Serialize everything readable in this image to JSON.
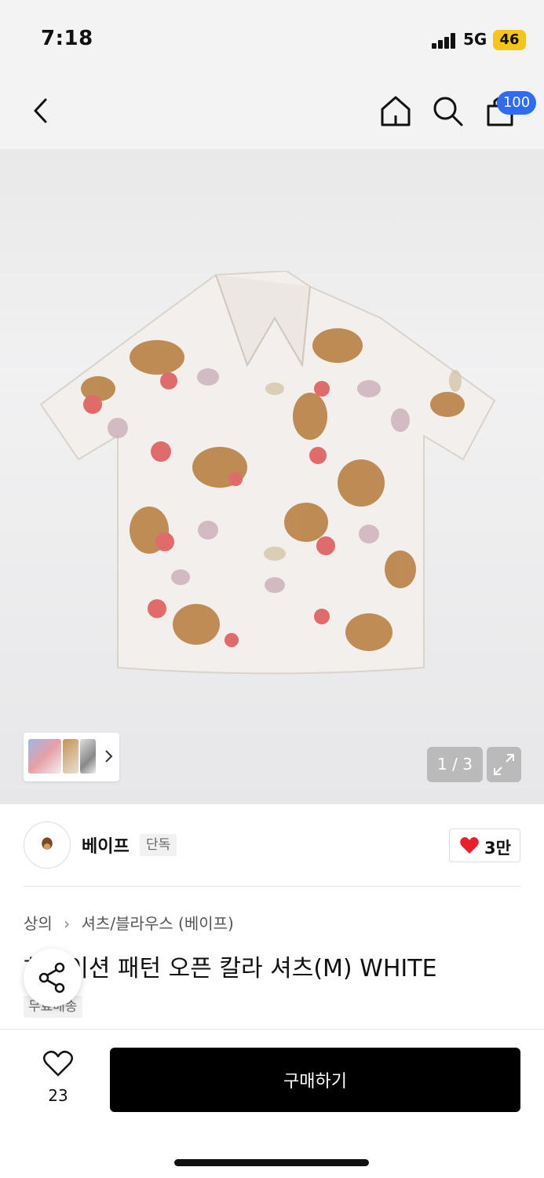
{
  "status_bar": {
    "time": "7:18",
    "network": "5G",
    "battery": "46"
  },
  "header": {
    "cart_count": "100"
  },
  "gallery": {
    "pager": "1 / 3"
  },
  "brand": {
    "name": "베이프",
    "exclusive_label": "단독",
    "like_count": "3만"
  },
  "breadcrumb": {
    "category": "상의",
    "subcategory": "셔츠/블라우스 (베이프)"
  },
  "product": {
    "title": "하와이션 패턴 오픈 칼라 셔츠(M) WHITE",
    "tag": "무료배송"
  },
  "bottom": {
    "wish_count": "23",
    "buy_label": "구매하기"
  },
  "colors": {
    "accent": "#2f6cf6",
    "heart": "#e8202a",
    "battery": "#f5c518"
  }
}
